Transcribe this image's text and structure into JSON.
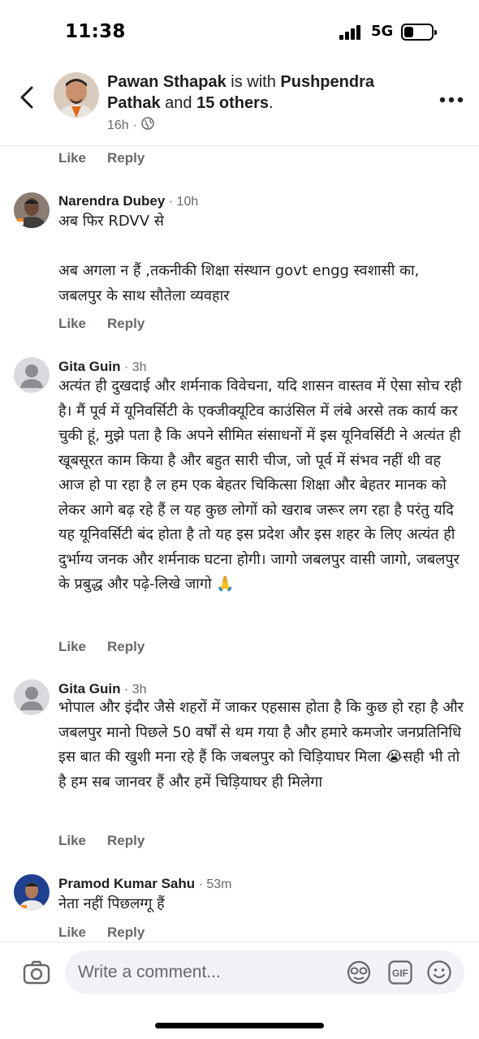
{
  "status_bar": {
    "time": "11:38",
    "network": "5G",
    "icons": [
      "signal-icon",
      "battery-icon"
    ]
  },
  "post_header": {
    "author": "Pawan Sthapak",
    "with_text": " is with ",
    "tagged": "Pushpendra Pathak",
    "and_text": " and ",
    "others": "15 others",
    "period": ".",
    "time": "16h",
    "separator": "·",
    "privacy_icon": "globe-icon",
    "back_icon": "chevron-left-icon",
    "more_icon": "more-dots-icon"
  },
  "actions": {
    "like": "Like",
    "reply": "Reply"
  },
  "comments": [
    {
      "name": "Narendra Dubey",
      "time": "10h",
      "text": "अब फिर RDVV से\n\nअब अगला न हैं ,तकनीकी शिक्षा संस्थान govt engg स्वशासी का,\nजबलपुर के साथ सौतेला व्यवहार"
    },
    {
      "name": "Gita Guin",
      "time": "3h",
      "text": "अत्यंत ही दुखदाई और शर्मनाक विवेचना, यदि शासन वास्तव में ऐसा सोच रही है। मैं पूर्व में यूनिवर्सिटी के एक्जीक्यूटिव काउंसिल में लंबे अरसे तक कार्य कर चुकी हूं, मुझे पता है कि अपने सीमित संसाधनों में इस यूनिवर्सिटी ने अत्यंत ही खूबसूरत काम किया है और बहुत सारी चीज, जो पूर्व में संभव नहीं थी वह आज हो पा रहा है ल हम एक बेहतर चिकित्सा शिक्षा और बेहतर मानक को लेकर आगे बढ़ रहे हैं ल यह कुछ लोगों को खराब जरूर लग रहा है परंतु यदि यह यूनिवर्सिटी बंद होता है तो यह इस प्रदेश और इस शहर के लिए अत्यंत ही दुर्भाग्य जनक और शर्मनाक घटना होगी। जागो जबलपुर वासी जागो, जबलपुर के प्रबुद्ध और पढ़े-लिखे जागो 🙏"
    },
    {
      "name": "Gita Guin",
      "time": "3h",
      "text": "भोपाल और इंदौर जैसे शहरों में जाकर एहसास होता है कि कुछ हो रहा है और जबलपुर मानो पिछले 50 वर्षों से थम गया है और हमारे कमजोर जनप्रतिनिधि इस बात की खुशी मना रहे हैं कि जबलपुर को चिड़ियाघर मिला 😭सही भी तो है हम सब जानवर हैं और हमें चिड़ियाघर ही मिलेगा"
    },
    {
      "name": "Pramod Kumar Sahu",
      "time": "53m",
      "text": "नेता नहीं पिछलग्गू हैं"
    }
  ],
  "composer": {
    "placeholder": "Write a comment...",
    "camera_icon": "camera-icon",
    "sticker_icon": "sticker-icon",
    "gif_icon": "gif-icon",
    "gif_label": "GIF",
    "emoji_icon": "emoji-icon"
  }
}
